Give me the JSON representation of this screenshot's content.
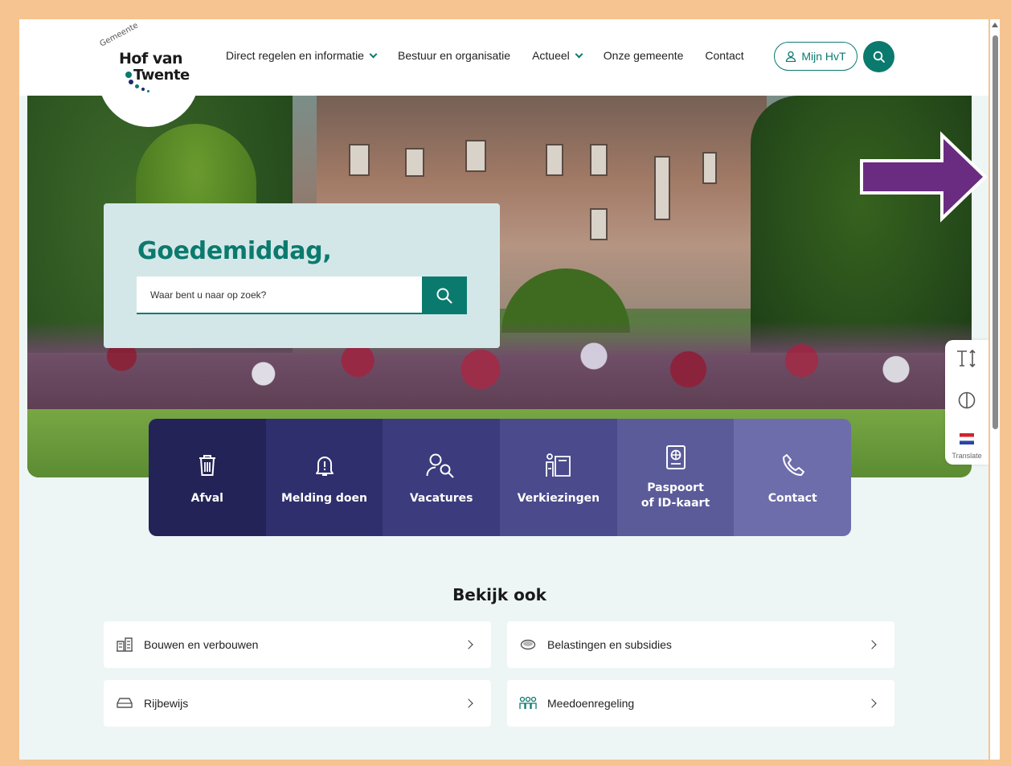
{
  "logo": {
    "arc_text": "Gemeente",
    "line1": "Hof van",
    "line2": "Twente"
  },
  "nav": {
    "items": [
      {
        "label": "Direct regelen en informatie",
        "has_dropdown": true
      },
      {
        "label": "Bestuur en organisatie",
        "has_dropdown": false
      },
      {
        "label": "Actueel",
        "has_dropdown": true
      },
      {
        "label": "Onze gemeente",
        "has_dropdown": false
      },
      {
        "label": "Contact",
        "has_dropdown": false
      }
    ],
    "account_label": "Mijn HvT",
    "search_icon": "search-icon"
  },
  "hero": {
    "greeting": "Goedemiddag,",
    "search_placeholder": "Waar bent u naar op zoek?"
  },
  "tiles": [
    {
      "label": "Afval",
      "icon": "trash-icon",
      "color": "#232357"
    },
    {
      "label": "Melding doen",
      "icon": "alert-bell-icon",
      "color": "#2f2f6e"
    },
    {
      "label": "Vacatures",
      "icon": "person-search-icon",
      "color": "#3b3b7e"
    },
    {
      "label": "Verkiezingen",
      "icon": "ballot-box-icon",
      "color": "#4a4a8c"
    },
    {
      "label": "Paspoort of ID-kaart",
      "icon": "passport-icon",
      "color": "#5b5b9a"
    },
    {
      "label": "Contact",
      "icon": "phone-icon",
      "color": "#6d6dab"
    }
  ],
  "side_tools": {
    "translate_label": "Translate"
  },
  "bekijk_ook": {
    "title": "Bekijk ook",
    "links": [
      {
        "label": "Bouwen en verbouwen",
        "icon": "building-icon"
      },
      {
        "label": "Belastingen en subsidies",
        "icon": "coins-icon"
      },
      {
        "label": "Rijbewijs",
        "icon": "car-icon"
      },
      {
        "label": "Meedoenregeling",
        "icon": "people-icon"
      }
    ]
  },
  "colors": {
    "brand": "#0b7a6e",
    "annotation_arrow": "#6a2c80",
    "frame": "#f5c491"
  }
}
